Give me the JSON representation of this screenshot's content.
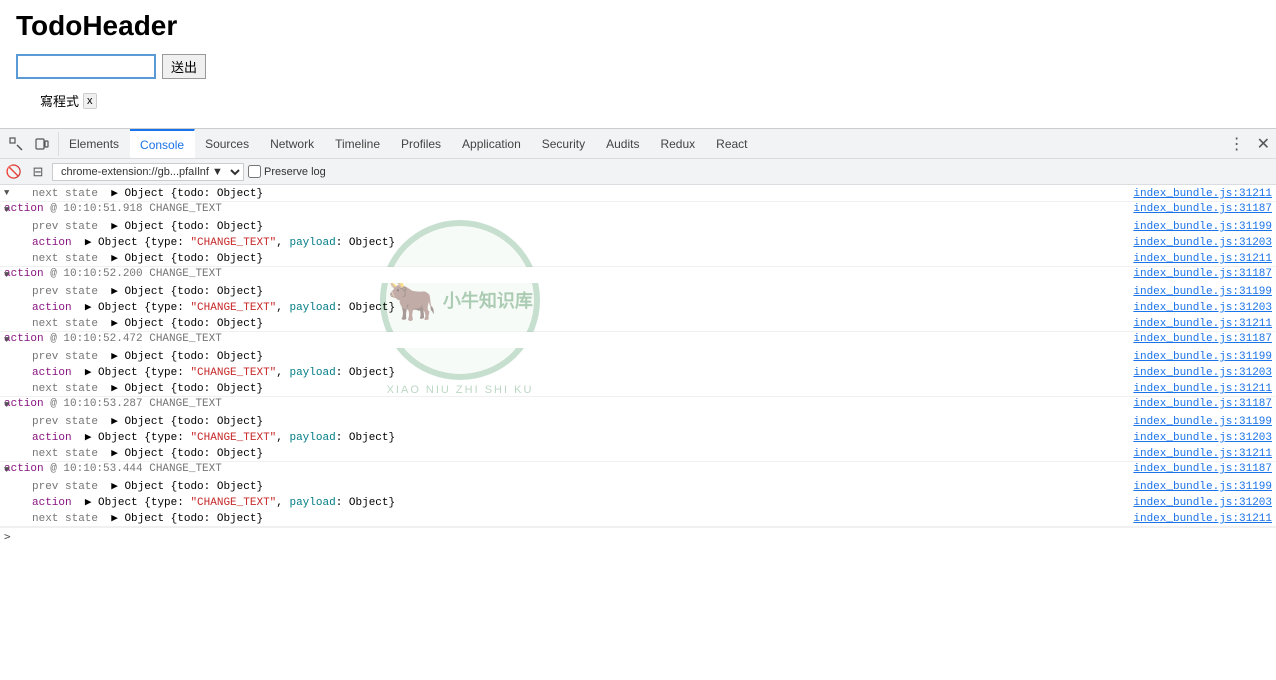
{
  "app": {
    "title": "TodoHeader",
    "input_placeholder": "",
    "submit_label": "送出",
    "todo_item": "寫程式",
    "todo_remove": "x"
  },
  "devtools": {
    "tabs": [
      {
        "label": "Elements",
        "active": false
      },
      {
        "label": "Console",
        "active": true
      },
      {
        "label": "Sources",
        "active": false
      },
      {
        "label": "Network",
        "active": false
      },
      {
        "label": "Timeline",
        "active": false
      },
      {
        "label": "Profiles",
        "active": false
      },
      {
        "label": "Application",
        "active": false
      },
      {
        "label": "Security",
        "active": false
      },
      {
        "label": "Audits",
        "active": false
      },
      {
        "label": "Redux",
        "active": false
      },
      {
        "label": "React",
        "active": false
      }
    ]
  },
  "console": {
    "url": "chrome-extension://gb...pfaIlnf ▼",
    "preserve_log_label": "Preserve log",
    "entries": [
      {
        "type": "next-state",
        "indent": "child",
        "text": "next state",
        "extra": "▶ Object {todo: Object}",
        "link": "index_bundle.js:31211"
      },
      {
        "type": "action-header",
        "indent": "header",
        "text": "action @ 10:10:51.918 CHANGE_TEXT",
        "link": "index_bundle.js:31187"
      },
      {
        "type": "prev-state",
        "indent": "child",
        "text": "prev state",
        "extra": "▶ Object {todo: Object}",
        "link": "index_bundle.js:31199"
      },
      {
        "type": "action",
        "indent": "child",
        "text": "action",
        "extra": "▶ Object {type: \"CHANGE_TEXT\", payload: Object}",
        "link": "index_bundle.js:31203"
      },
      {
        "type": "next-state",
        "indent": "child",
        "text": "next state",
        "extra": "▶ Object {todo: Object}",
        "link": "index_bundle.js:31211"
      },
      {
        "type": "action-header",
        "indent": "header",
        "text": "action @ 10:10:52.200 CHANGE_TEXT",
        "link": "index_bundle.js:31187"
      },
      {
        "type": "prev-state",
        "indent": "child",
        "text": "prev state",
        "extra": "▶ Object {todo: Object}",
        "link": "index_bundle.js:31199"
      },
      {
        "type": "action",
        "indent": "child",
        "text": "action",
        "extra": "▶ Object {type: \"CHANGE_TEXT\", payload: Object}",
        "link": "index_bundle.js:31203"
      },
      {
        "type": "next-state",
        "indent": "child",
        "text": "next state",
        "extra": "▶ Object {todo: Object}",
        "link": "index_bundle.js:31211"
      },
      {
        "type": "action-header",
        "indent": "header",
        "text": "action @ 10:10:52.472 CHANGE_TEXT",
        "link": "index_bundle.js:31187"
      },
      {
        "type": "prev-state",
        "indent": "child",
        "text": "prev state",
        "extra": "▶ Object {todo: Object}",
        "link": "index_bundle.js:31199"
      },
      {
        "type": "action",
        "indent": "child",
        "text": "action",
        "extra": "▶ Object {type: \"CHANGE_TEXT\", payload: Object}",
        "link": "index_bundle.js:31203"
      },
      {
        "type": "next-state",
        "indent": "child",
        "text": "next state",
        "extra": "▶ Object {todo: Object}",
        "link": "index_bundle.js:31211"
      },
      {
        "type": "action-header",
        "indent": "header",
        "text": "action @ 10:10:53.287 CHANGE_TEXT",
        "link": "index_bundle.js:31187"
      },
      {
        "type": "prev-state",
        "indent": "child",
        "text": "prev state",
        "extra": "▶ Object {todo: Object}",
        "link": "index_bundle.js:31199"
      },
      {
        "type": "action",
        "indent": "child",
        "text": "action",
        "extra": "▶ Object {type: \"CHANGE_TEXT\", payload: Object}",
        "link": "index_bundle.js:31203"
      },
      {
        "type": "next-state",
        "indent": "child",
        "text": "next state",
        "extra": "▶ Object {todo: Object}",
        "link": "index_bundle.js:31211"
      },
      {
        "type": "action-header",
        "indent": "header",
        "text": "action @ 10:10:53.444 CHANGE_TEXT",
        "link": "index_bundle.js:31187"
      },
      {
        "type": "prev-state",
        "indent": "child",
        "text": "prev state",
        "extra": "▶ Object {todo: Object}",
        "link": "index_bundle.js:31199"
      },
      {
        "type": "action",
        "indent": "child",
        "text": "action",
        "extra": "▶ Object {type: \"CHANGE_TEXT\", payload: Object}",
        "link": "index_bundle.js:31203"
      },
      {
        "type": "next-state",
        "indent": "child",
        "text": "next state",
        "extra": "▶ Object {todo: Object}",
        "link": "index_bundle.js:31211"
      }
    ]
  },
  "watermark": {
    "cn_text": "小牛知识库",
    "en_text": "XIAO NIU ZHI SHI KU"
  }
}
